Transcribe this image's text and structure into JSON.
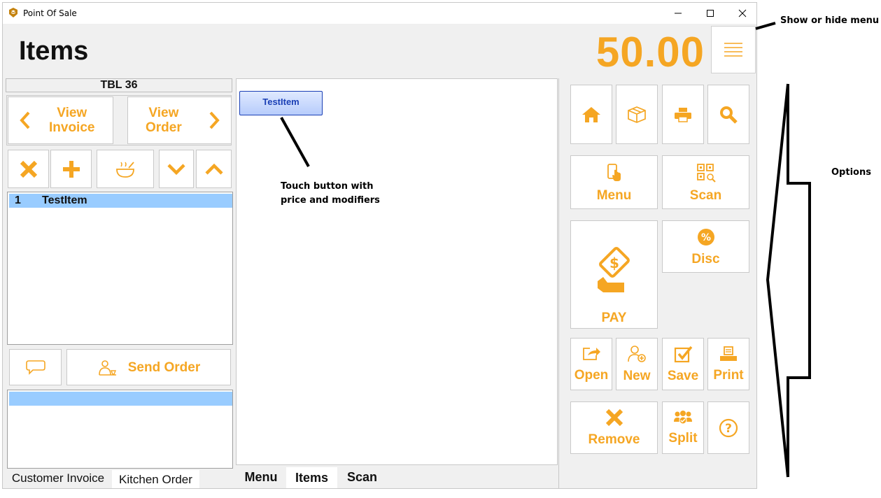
{
  "window": {
    "title": "Point Of Sale"
  },
  "header": {
    "page_title": "Items",
    "total": "50.00"
  },
  "left": {
    "table_label": "TBL 36",
    "view_invoice": "View\nInvoice",
    "view_order": "View\nOrder",
    "order_items": [
      {
        "qty": "1",
        "name": "TestItem"
      }
    ],
    "send_order": "Send Order",
    "tabs": [
      "Customer Invoice",
      "Kitchen Order"
    ]
  },
  "center": {
    "item_button": "TestItem",
    "tabs": [
      "Menu",
      "Items",
      "Scan"
    ]
  },
  "right": {
    "menu": "Menu",
    "scan": "Scan",
    "pay": "PAY",
    "disc": "Disc",
    "open": "Open",
    "new": "New",
    "save": "Save",
    "print": "Print",
    "remove": "Remove",
    "split": "Split"
  },
  "annotations": {
    "menu_toggle": "Show or hide menu",
    "touch_button": "Touch button with\nprice and modifiers",
    "options": "Options"
  },
  "colors": {
    "accent": "#f5a623",
    "selection": "#99ccff",
    "item_button_border": "#1a3fb5"
  }
}
